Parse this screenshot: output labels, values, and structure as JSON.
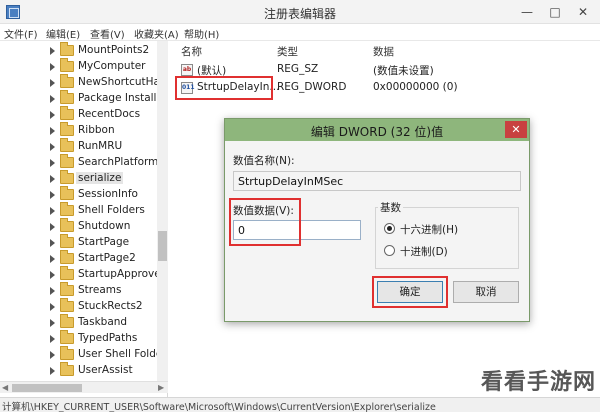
{
  "window": {
    "title": "注册表编辑器"
  },
  "menu": [
    "文件(F)",
    "编辑(E)",
    "查看(V)",
    "收藏夹(A)",
    "帮助(H)"
  ],
  "tree": {
    "items": [
      "MountPoints2",
      "MyComputer",
      "NewShortcutHan",
      "Package Installat",
      "RecentDocs",
      "Ribbon",
      "RunMRU",
      "SearchPlatform",
      "serialize",
      "SessionInfo",
      "Shell Folders",
      "Shutdown",
      "StartPage",
      "StartPage2",
      "StartupApproved",
      "Streams",
      "StuckRects2",
      "Taskband",
      "TypedPaths",
      "User Shell Folder",
      "UserAssist"
    ],
    "selected": "serialize"
  },
  "list": {
    "columns": [
      "名称",
      "类型",
      "数据"
    ],
    "rows": [
      {
        "icon": "ab",
        "name": "(默认)",
        "type": "REG_SZ",
        "data": "(数值未设置)"
      },
      {
        "icon": "011",
        "name": "StrtupDelayIn...",
        "type": "REG_DWORD",
        "data": "0x00000000 (0)"
      }
    ]
  },
  "dialog": {
    "title": "编辑 DWORD (32 位)值",
    "close_glyph": "✕",
    "name_label": "数值名称(N):",
    "name_value": "StrtupDelayInMSec",
    "data_label": "数值数据(V):",
    "data_value": "0",
    "base_label": "基数",
    "hex_label": "十六进制(H)",
    "dec_label": "十进制(D)",
    "selected_base": "hex",
    "ok_label": "确定",
    "cancel_label": "取消"
  },
  "status": {
    "path": "计算机\\HKEY_CURRENT_USER\\Software\\Microsoft\\Windows\\CurrentVersion\\Explorer\\serialize"
  },
  "watermark": "看看手游网",
  "colors": {
    "highlight": "#e03030",
    "dialog_title": "#8eb67c",
    "close_button": "#c84040"
  }
}
